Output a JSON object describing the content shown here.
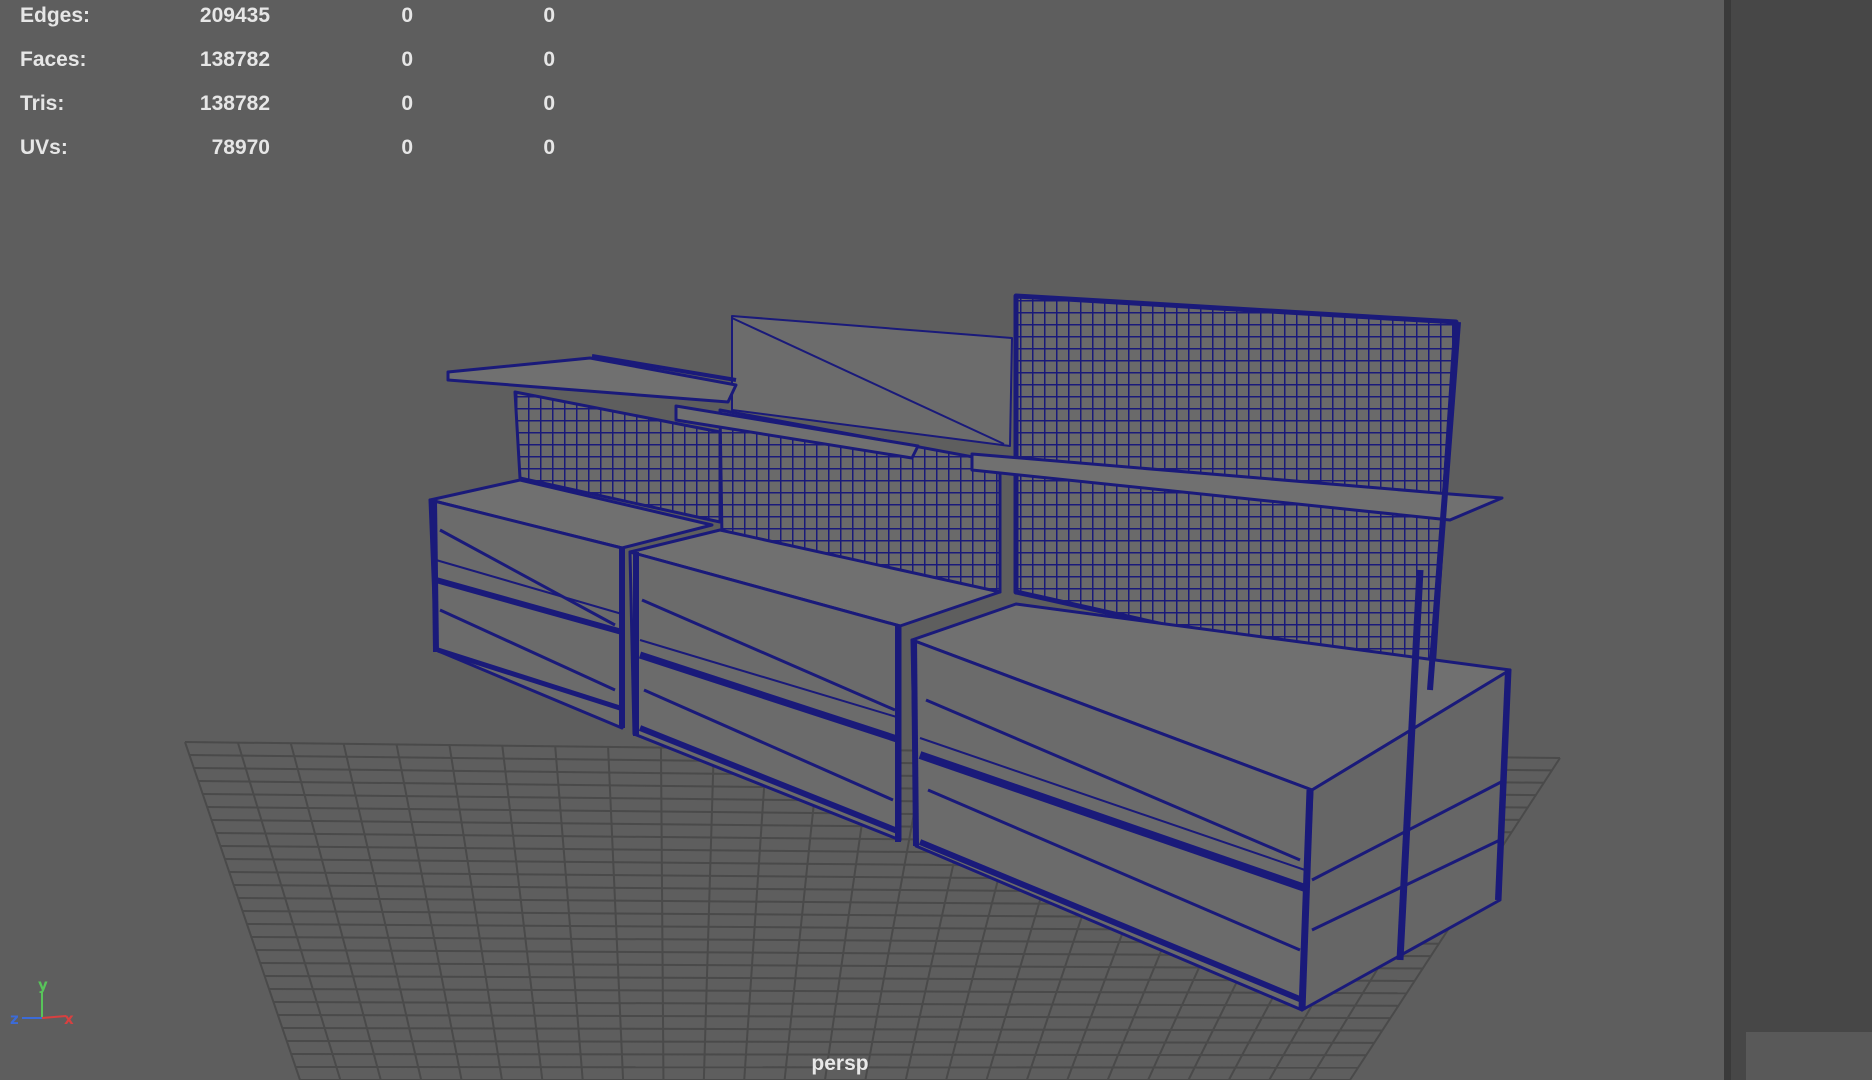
{
  "hud": {
    "rows": [
      {
        "label": "Edges:",
        "v1": "209435",
        "v2": "0",
        "v3": "0"
      },
      {
        "label": "Faces:",
        "v1": "138782",
        "v2": "0",
        "v3": "0"
      },
      {
        "label": "Tris:",
        "v1": "138782",
        "v2": "0",
        "v3": "0"
      },
      {
        "label": "UVs:",
        "v1": "78970",
        "v2": "0",
        "v3": "0"
      }
    ]
  },
  "viewport": {
    "camera_label": "persp",
    "wire_color": "#1a1a7a",
    "grid_color": "#4a4a4a",
    "axis": {
      "y": "y",
      "z": "z",
      "x": "x"
    }
  }
}
